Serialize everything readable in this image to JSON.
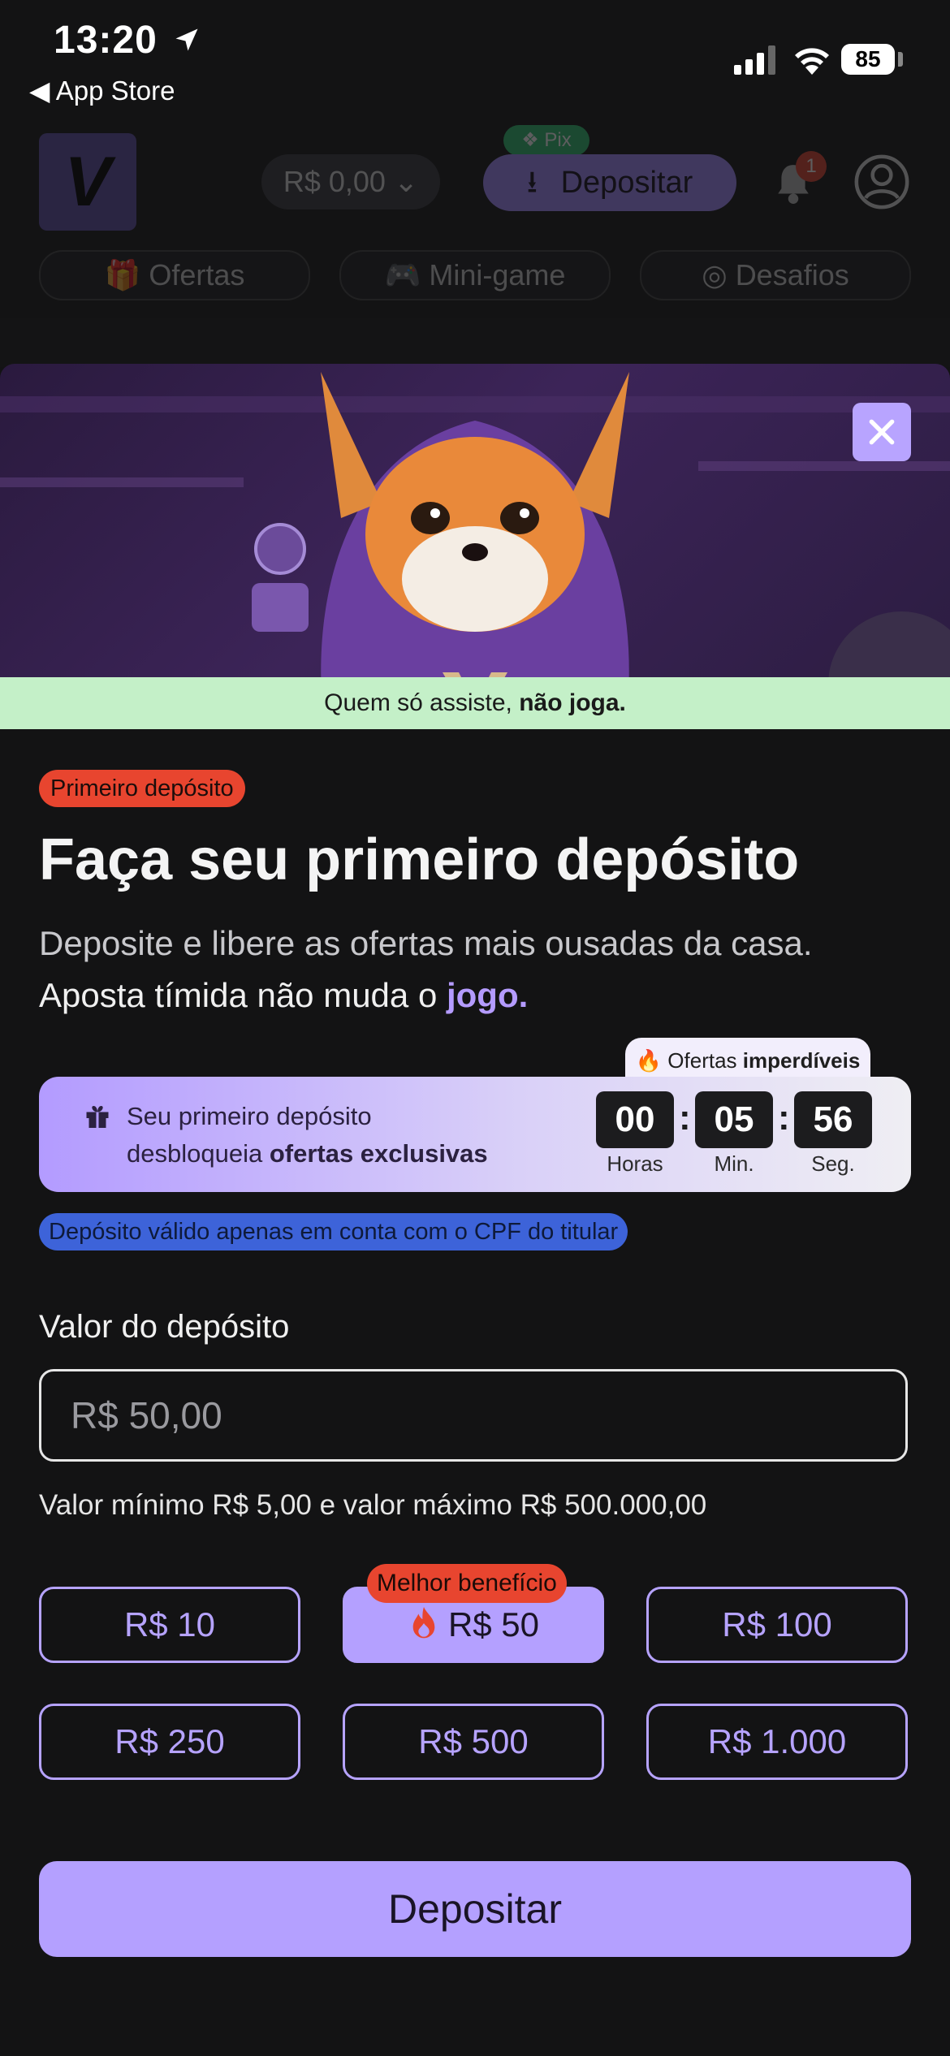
{
  "status_bar": {
    "time": "13:20",
    "back_label": "◀ App Store",
    "battery": "85"
  },
  "header": {
    "logo_letter": "V",
    "balance": "R$ 0,00",
    "deposit_label": "Depositar",
    "pix_label": "Pix",
    "notification_count": "1",
    "nav": [
      "Ofertas",
      "Mini-game",
      "Desafios"
    ]
  },
  "banner": {
    "tagline_prefix": "Quem só assiste, ",
    "tagline_bold": "não joga."
  },
  "modal": {
    "badge": "Primeiro depósito",
    "title": "Faça seu primeiro depósito",
    "subtitle_line1": "Deposite e libere as ofertas mais ousadas da casa.",
    "subtitle_line2_prefix": "Aposta tímida não muda o ",
    "subtitle_line2_accent": "jogo."
  },
  "offer": {
    "tab_prefix": "Ofertas ",
    "tab_bold": "imperdíveis",
    "line1": "Seu primeiro depósito",
    "line2_prefix": "desbloqueia ",
    "line2_bold": "ofertas exclusivas",
    "timer": {
      "hours": "00",
      "minutes": "05",
      "seconds": "56"
    },
    "timer_labels": {
      "hours": "Horas",
      "minutes": "Min.",
      "seconds": "Seg."
    }
  },
  "cpf_note": "Depósito válido apenas em conta com o CPF do titular",
  "amount": {
    "label": "Valor do depósito",
    "placeholder": "R$ 50,00",
    "limits": "Valor mínimo R$ 5,00 e valor máximo R$ 500.000,00",
    "best_badge": "Melhor benefício",
    "options": [
      "R$ 10",
      "R$ 50",
      "R$ 100",
      "R$ 250",
      "R$ 500",
      "R$ 1.000"
    ],
    "selected": "R$ 50"
  },
  "submit_label": "Depositar",
  "colors": {
    "accent": "#b4a0ff",
    "badge_red": "#e8452f",
    "note_blue": "#3d63d9",
    "background": "#131314"
  }
}
